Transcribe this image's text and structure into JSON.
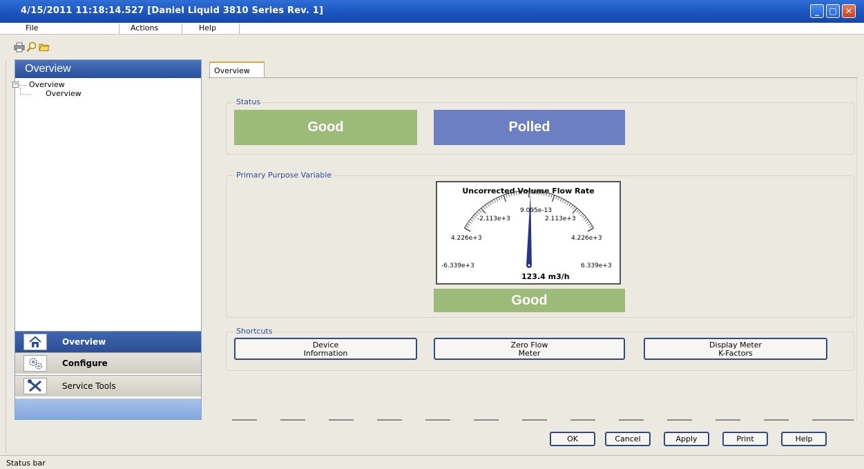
{
  "window": {
    "title": "4/15/2011 11:18:14.527 [Daniel Liquid 3810 Series Rev. 1]",
    "minimize_glyph": "_",
    "maximize_glyph": "□",
    "close_glyph": "✕"
  },
  "menubar": {
    "items": [
      {
        "label": "File"
      },
      {
        "label": "Actions"
      },
      {
        "label": "Help"
      }
    ]
  },
  "toolbar": {
    "icons": [
      "print-icon",
      "search-icon",
      "folder-open-icon"
    ]
  },
  "left_panel": {
    "header": "Overview",
    "tree": {
      "root_label": "Overview",
      "child_label": "Overview",
      "expander_glyph": "−"
    },
    "nav": [
      {
        "label": "Overview",
        "icon": "home-icon",
        "active": true
      },
      {
        "label": "Configure",
        "icon": "gears-icon",
        "active": false
      },
      {
        "label": "Service Tools",
        "icon": "tools-icon",
        "active": false
      }
    ]
  },
  "main": {
    "tab_label": "Overview",
    "status_group": {
      "label": "Status",
      "primary": "Good",
      "secondary": "Polled"
    },
    "ppv_group": {
      "label": "Primary Purpose Variable",
      "gauge": {
        "title": "Uncorrected Volume Flow Rate",
        "ticks": [
          "9.095e-13",
          "-2.113e+3",
          "2.113e+3",
          "4.226e+3",
          "4.226e+3",
          "-6.339e+3",
          "6.339e+3"
        ],
        "value_text": "123.4 m3/h",
        "value": 123.4,
        "min": -6339,
        "max": 6339
      },
      "status": "Good"
    },
    "shortcuts_group": {
      "label": "Shortcuts",
      "buttons": [
        {
          "line1": "Device",
          "line2": "Information"
        },
        {
          "line1": "Zero Flow",
          "line2": "Meter"
        },
        {
          "line1": "Display Meter",
          "line2": "K-Factors"
        }
      ]
    }
  },
  "dialog_buttons": {
    "ok": "OK",
    "cancel": "Cancel",
    "apply": "Apply",
    "print": "Print",
    "help": "Help"
  },
  "statusbar": {
    "text": "Status bar"
  },
  "colors": {
    "good": "#9cba78",
    "polled": "#6d7fc3",
    "titlebar": "#1d55c0",
    "nav_active": "#2b4f96",
    "group_label": "#2b4fa0"
  }
}
